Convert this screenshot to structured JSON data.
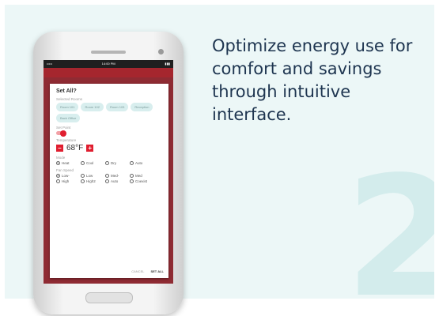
{
  "tagline": "Optimize energy use for comfort and savings through intuitive interface.",
  "step_number": "2",
  "phone": {
    "status": {
      "left": "•••••",
      "center": "14:00 PM",
      "right": "▮▮▮"
    },
    "dialog": {
      "title": "Set All?",
      "selected_label": "Selected Rooms",
      "chips": [
        "Room 101",
        "Room 102",
        "Room 103",
        "Reception",
        "Back Office"
      ],
      "setpoint_label": "Set Point",
      "temperature_label": "Temperature",
      "temp_minus": "–",
      "temperature_value": "68°F",
      "temp_plus": "+",
      "mode_label": "Mode",
      "modes": [
        {
          "label": "Heat",
          "selected": true
        },
        {
          "label": "Cool",
          "selected": false
        },
        {
          "label": "Dry",
          "selected": false
        },
        {
          "label": "Auto",
          "selected": false
        }
      ],
      "fanspeed_label": "Fan Speed",
      "fan_speeds": [
        {
          "label": "Low-",
          "selected": true
        },
        {
          "label": "Low",
          "selected": false
        },
        {
          "label": "Med-",
          "selected": false
        },
        {
          "label": "Med",
          "selected": false
        },
        {
          "label": "High",
          "selected": false
        },
        {
          "label": "High2",
          "selected": false
        },
        {
          "label": "Auto",
          "selected": false
        },
        {
          "label": "Coexist",
          "selected": false
        }
      ],
      "cancel_label": "CANCEL",
      "set_all_label": "SET ALL"
    }
  },
  "colors": {
    "accent": "#e01e2f",
    "panel": "#ecf7f7",
    "text": "#1e3550",
    "chip": "#d8eeee"
  }
}
